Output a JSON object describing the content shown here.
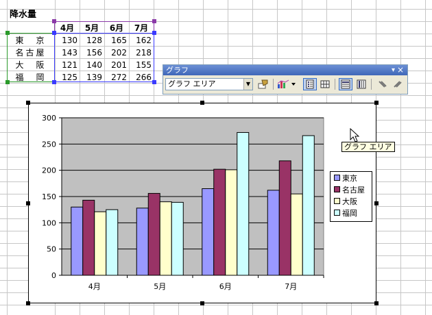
{
  "sheet": {
    "title": "降水量",
    "col_headers": [
      "4月",
      "5月",
      "6月",
      "7月"
    ],
    "rows": [
      {
        "label": "東　京",
        "values": [
          "130",
          "128",
          "165",
          "162"
        ]
      },
      {
        "label": "名古屋",
        "values": [
          "143",
          "156",
          "202",
          "218"
        ]
      },
      {
        "label": "大　阪",
        "values": [
          "121",
          "140",
          "201",
          "155"
        ]
      },
      {
        "label": "福　岡",
        "values": [
          "125",
          "139",
          "272",
          "266"
        ]
      }
    ]
  },
  "toolbar": {
    "title": "グラフ",
    "combo_value": "グラフ エリア",
    "menu_glyph": "▾",
    "close_glyph": "×",
    "combo_arrow": "▼",
    "buttons": [
      "format-selected-icon",
      "chart-type-icon",
      "legend-icon",
      "data-table-icon",
      "by-row-icon",
      "by-column-icon",
      "angle-down-icon",
      "angle-up-icon"
    ]
  },
  "tooltip": "グラフ エリア",
  "chart_data": {
    "type": "bar",
    "categories": [
      "4月",
      "5月",
      "6月",
      "7月"
    ],
    "series": [
      {
        "name": "東京",
        "values": [
          130,
          128,
          165,
          162
        ],
        "color": "#9999ff"
      },
      {
        "name": "名古屋",
        "values": [
          143,
          156,
          202,
          218
        ],
        "color": "#993366"
      },
      {
        "name": "大阪",
        "values": [
          121,
          140,
          201,
          155
        ],
        "color": "#ffffcc"
      },
      {
        "name": "福岡",
        "values": [
          125,
          139,
          272,
          266
        ],
        "color": "#ccffff"
      }
    ],
    "ylim": [
      0,
      300
    ],
    "yticks": [
      "0",
      "50",
      "100",
      "150",
      "200",
      "250",
      "300"
    ],
    "grid": true,
    "plot_bg": "#c0c0c0",
    "legend_position": "right"
  }
}
